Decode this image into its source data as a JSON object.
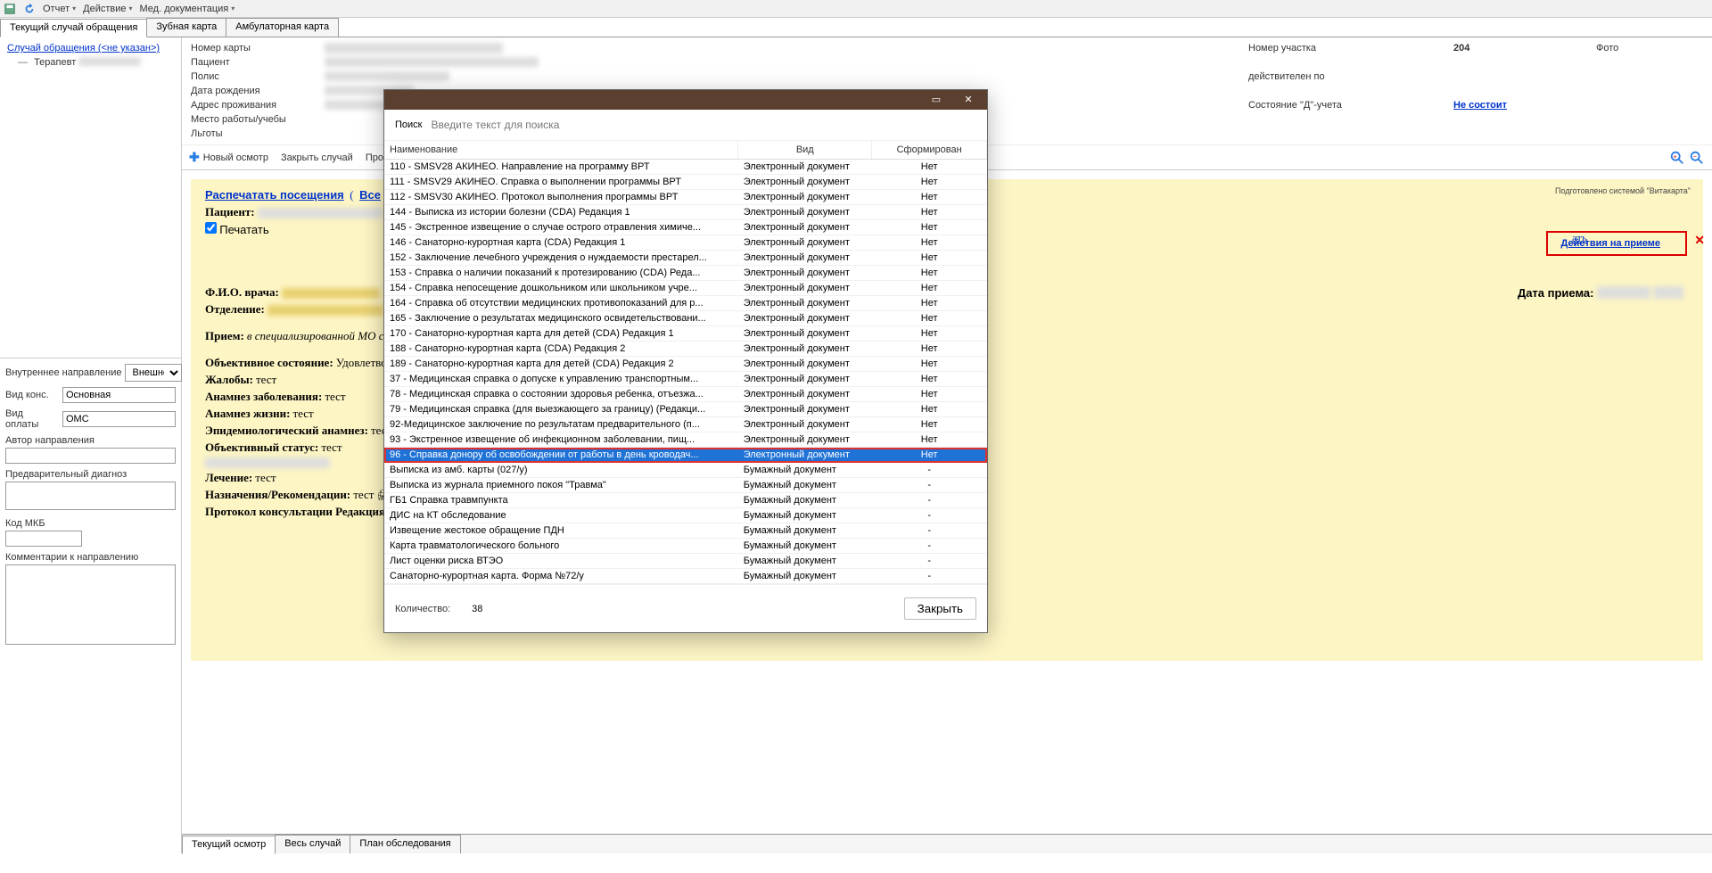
{
  "toolbar": {
    "report": "Отчет",
    "action": "Действие",
    "meddoc": "Мед. документация"
  },
  "tabs": {
    "t0": "Текущий случай обращения",
    "t1": "Зубная карта",
    "t2": "Амбулаторная карта"
  },
  "tree": {
    "case": "Случай обращения (<не указан>)",
    "therapist": "Терапевт"
  },
  "left_form": {
    "dir_internal": "Внутреннее направление",
    "dir_external": "Внешне",
    "cons_lbl": "Вид конс.",
    "cons_val": "Основная",
    "pay_lbl": "Вид оплаты",
    "pay_val": "ОМС",
    "author_lbl": "Автор направления",
    "diag_lbl": "Предварительный диагноз",
    "mkb_lbl": "Код МКБ",
    "comments_lbl": "Комментарии к направлению"
  },
  "patient": {
    "card_no_lbl": "Номер карты",
    "patient_lbl": "Пациент",
    "polis_lbl": "Полис",
    "dob_lbl": "Дата рождения",
    "addr_lbl": "Адрес проживания",
    "work_lbl": "Место работы/учебы",
    "benefits_lbl": "Льготы",
    "area_lbl": "Номер участка",
    "area_val": "204",
    "valid_lbl": "действителен по",
    "dstate_lbl": "Состояние \"Д\"-учета",
    "dstate_val": "Не состоит",
    "photo_lbl": "Фото"
  },
  "sec": {
    "new": "Новый осмотр",
    "close": "Закрыть случай",
    "view": "Просм"
  },
  "doc": {
    "print_visits": "Распечатать посещения",
    "all": "Все",
    "patient_lbl": "Пациент:",
    "print_chk": "Печатать",
    "fio_lbl": "Ф.И.О. врача:",
    "dept_lbl": "Отделение:",
    "reception_lbl": "Прием:",
    "reception_val": "в специализированной МО с це",
    "obj_state_lbl": "Объективное состояние:",
    "obj_state_val": "Удовлетвор",
    "complaints_lbl": "Жалобы:",
    "complaints_val": "тест",
    "anam_dis_lbl": "Анамнез заболевания:",
    "anam_dis_val": "тест",
    "anam_life_lbl": "Анамнез жизни:",
    "anam_life_val": "тест",
    "epid_lbl": "Эпидемиологический анамнез:",
    "epid_val": "тест",
    "obj_status_lbl": "Объективный статус:",
    "obj_status_val": "тест",
    "treat_lbl": "Лечение:",
    "treat_val": "тест",
    "recom_lbl": "Назначения/Рекомендации:",
    "recom_val": "тест",
    "proto_lbl": "Протокол консультации Редакция 2",
    "watermark": "Подготовлено системой \"Витакарта\"",
    "actions": "Действия на приеме",
    "actions_tail": "ать",
    "date_lbl": "Дата приема:"
  },
  "bottom_tabs": {
    "t0": "Текущий осмотр",
    "t1": "Весь случай",
    "t2": "План обследования"
  },
  "modal": {
    "search_lbl": "Поиск",
    "search_ph": "Введите текст для поиска",
    "col0": "Наименование",
    "col1": "Вид",
    "col2": "Сформирован",
    "count_lbl": "Количество:",
    "count_val": "38",
    "close": "Закрыть",
    "kind_e": "Электронный документ",
    "kind_p": "Бумажный документ",
    "no": "Нет",
    "dash": "-",
    "rows": [
      {
        "n": "110 - SMSV28 АКИНЕО. Направление на программу ВРТ",
        "k": "e",
        "f": "n"
      },
      {
        "n": "111 - SMSV29 АКИНЕО. Справка о выполнении программы ВРТ",
        "k": "e",
        "f": "n"
      },
      {
        "n": "112 - SMSV30 АКИНЕО. Протокол выполнения программы ВРТ",
        "k": "e",
        "f": "n"
      },
      {
        "n": "144 -  Выписка из истории болезни (CDA) Редакция 1",
        "k": "e",
        "f": "n"
      },
      {
        "n": "145 - Экстренное извещение о случае острого отравления химиче...",
        "k": "e",
        "f": "n"
      },
      {
        "n": "146 - Санаторно-курортная карта (CDA) Редакция 1",
        "k": "e",
        "f": "n"
      },
      {
        "n": "152 - Заключение лечебного учреждения о нуждаемости престарел...",
        "k": "e",
        "f": "n"
      },
      {
        "n": "153 - Справка о наличии показаний к протезированию (CDA) Реда...",
        "k": "e",
        "f": "n"
      },
      {
        "n": "154 - Справка непосещение дошкольником или школьником учре...",
        "k": "e",
        "f": "n"
      },
      {
        "n": "164 - Справка об отсутствии медицинских противопоказаний для р...",
        "k": "e",
        "f": "n"
      },
      {
        "n": "165 - Заключение о результатах медицинского освидетельствовани...",
        "k": "e",
        "f": "n"
      },
      {
        "n": "170 - Санаторно-курортная карта для детей (CDA) Редакция 1",
        "k": "e",
        "f": "n"
      },
      {
        "n": "188 - Санаторно-курортная карта (CDA) Редакция 2",
        "k": "e",
        "f": "n"
      },
      {
        "n": "189 - Санаторно-курортная карта для детей (CDA) Редакция 2",
        "k": "e",
        "f": "n"
      },
      {
        "n": "37 - Медицинская справка о допуске к управлению транспортным...",
        "k": "e",
        "f": "n"
      },
      {
        "n": "78 - Медицинская справка о состоянии здоровья ребенка, отъезжа...",
        "k": "e",
        "f": "n"
      },
      {
        "n": "79 - Медицинская справка (для выезжающего за границу) (Редакци...",
        "k": "e",
        "f": "n"
      },
      {
        "n": "92-Медицинское заключение по результатам предварительного (п...",
        "k": "e",
        "f": "n"
      },
      {
        "n": "93 - Экстренное извещение об инфекционном заболевании, пищ...",
        "k": "e",
        "f": "n"
      },
      {
        "n": "96 - Справка донору об освобождении от работы в день кроводач...",
        "k": "e",
        "f": "n",
        "sel": true
      },
      {
        "n": "Выписка из амб. карты (027/у)",
        "k": "p",
        "f": "-"
      },
      {
        "n": "Выписка из журнала приемного покоя \"Травма\"",
        "k": "p",
        "f": "-"
      },
      {
        "n": "ГБ1 Справка травмпункта",
        "k": "p",
        "f": "-"
      },
      {
        "n": "ДИС на КТ обследование",
        "k": "p",
        "f": "-"
      },
      {
        "n": "Извещение жестокое обращение ПДН",
        "k": "p",
        "f": "-"
      },
      {
        "n": "Карта травматологического больного",
        "k": "p",
        "f": "-"
      },
      {
        "n": "Лист оценки риска ВТЭО",
        "k": "p",
        "f": "-"
      },
      {
        "n": "Санаторно-курортная карта. Форма №72/у",
        "k": "p",
        "f": "-"
      }
    ]
  }
}
